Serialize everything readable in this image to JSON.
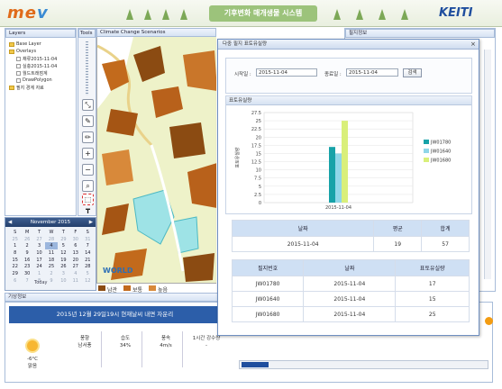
{
  "header": {
    "logo_text": "me",
    "logo_v": "v",
    "site_title": "기후변화 매개생물 시스템",
    "brand": "KEITI"
  },
  "layers": {
    "title": "Layers",
    "items": [
      {
        "label": "Base Layer",
        "depth": 0
      },
      {
        "label": "Overlays",
        "depth": 0
      },
      {
        "label": "채류2015-11-04",
        "depth": 1
      },
      {
        "label": "실충2015-11-04",
        "depth": 1
      },
      {
        "label": "월드트래점계",
        "depth": 1
      },
      {
        "label": "DrawPolygon",
        "depth": 1
      },
      {
        "label": "필지 경계 자료",
        "depth": 0
      }
    ]
  },
  "tools": {
    "title": "Tools"
  },
  "map": {
    "tab": "Climate Change Scenarios",
    "watermark": "WORLD",
    "legend": [
      "남관",
      "보통",
      "높음"
    ]
  },
  "right_panel": {
    "title": "필지정보"
  },
  "calendar": {
    "month": "November 2015",
    "days_header": [
      "S",
      "M",
      "T",
      "W",
      "T",
      "F",
      "S"
    ],
    "weeks": [
      [
        "25",
        "26",
        "27",
        "28",
        "29",
        "30",
        "31"
      ],
      [
        "1",
        "2",
        "3",
        "4",
        "5",
        "6",
        "7"
      ],
      [
        "8",
        "9",
        "10",
        "11",
        "12",
        "13",
        "14"
      ],
      [
        "15",
        "16",
        "17",
        "18",
        "19",
        "20",
        "21"
      ],
      [
        "22",
        "23",
        "24",
        "25",
        "26",
        "27",
        "28"
      ],
      [
        "29",
        "30",
        "1",
        "2",
        "3",
        "4",
        "5"
      ],
      [
        "6",
        "7",
        "8",
        "9",
        "10",
        "11",
        "12"
      ]
    ],
    "today_label": "Today"
  },
  "weather": {
    "title": "기상정보",
    "headline": "2015년 12월 29일19시 현재날씨 내면 자운리",
    "temp": "-6°C",
    "sky": "맑음",
    "cells": [
      {
        "label": "풍향",
        "value": "남서풍"
      },
      {
        "label": "습도",
        "value": "34%"
      },
      {
        "label": "풍속",
        "value": "4m/s"
      },
      {
        "label": "1시간 강수량",
        "value": "-"
      }
    ]
  },
  "dialog": {
    "title": "다중 필지 표토유실량",
    "start_label": "시작일 :",
    "start_value": "2015-11-04",
    "end_label": "종료일 :",
    "end_value": "2015-11-04",
    "search_label": "검색",
    "chart_section": "표토유실량",
    "summary_headers": [
      "날짜",
      "평균",
      "합계"
    ],
    "summary_row": [
      "2015-11-04",
      "19",
      "57"
    ],
    "detail_headers": [
      "필지번호",
      "날짜",
      "표토유실량"
    ],
    "detail_rows": [
      [
        "JW01780",
        "2015-11-04",
        "17"
      ],
      [
        "JW01640",
        "2015-11-04",
        "15"
      ],
      [
        "JW01680",
        "2015-11-04",
        "25"
      ]
    ]
  },
  "chart_data": {
    "type": "bar",
    "categories": [
      "2015-11-04"
    ],
    "series": [
      {
        "name": "JW01780",
        "values": [
          17
        ],
        "color": "#17a2a8"
      },
      {
        "name": "JW01640",
        "values": [
          15
        ],
        "color": "#8fd6e8"
      },
      {
        "name": "JW01680",
        "values": [
          25
        ],
        "color": "#d9ef7a"
      }
    ],
    "yticks": [
      "27.5",
      "25",
      "22.5",
      "20",
      "17.5",
      "15",
      "12.5",
      "10",
      "7.5",
      "5",
      "2.5",
      "0"
    ],
    "ylim": [
      0,
      27.5
    ],
    "ylabel": "표토유실량",
    "legend_position": "right"
  }
}
